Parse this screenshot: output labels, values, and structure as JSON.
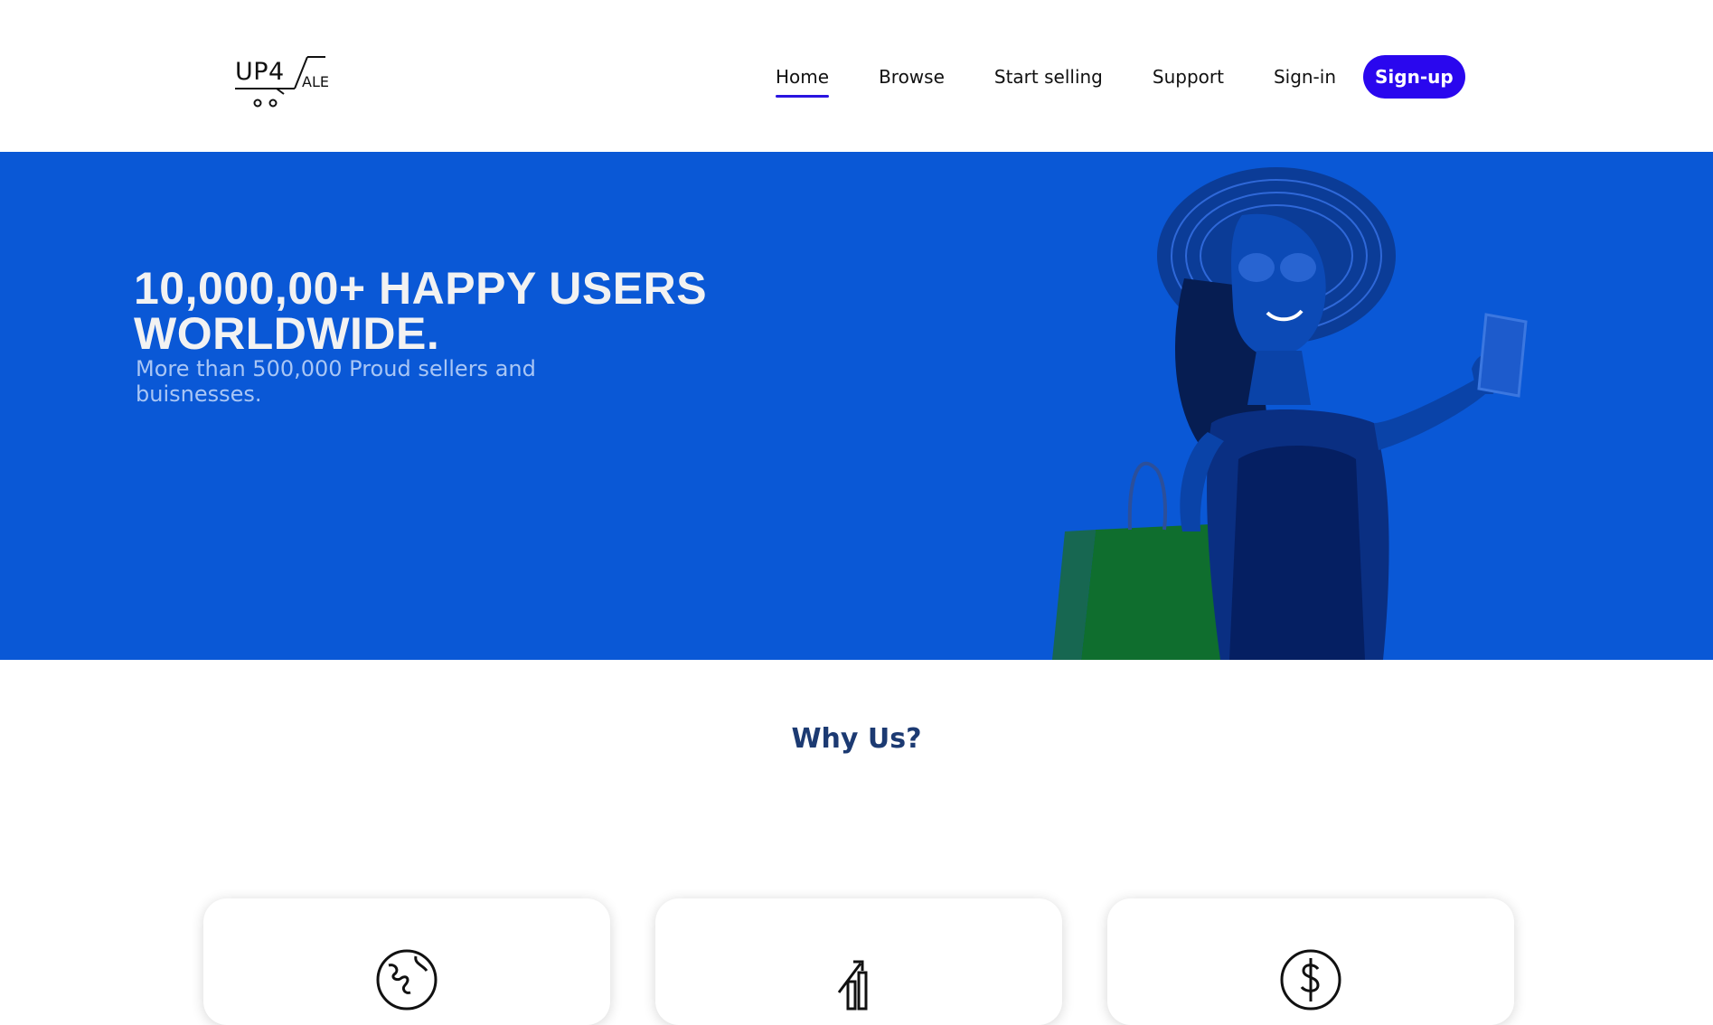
{
  "brand": {
    "logo_main": "UP4",
    "logo_sub": "ALE"
  },
  "nav": {
    "items": [
      {
        "label": "Home",
        "active": true
      },
      {
        "label": "Browse",
        "active": false
      },
      {
        "label": "Start selling",
        "active": false
      },
      {
        "label": "Support",
        "active": false
      },
      {
        "label": "Sign-in",
        "active": false
      }
    ],
    "signup_label": "Sign-up"
  },
  "hero": {
    "title_line1": "10,000,00+ HAPPY USERS",
    "title_line2": "WORLDWIDE.",
    "subtitle": "More than 500,000 Proud sellers and buisnesses.",
    "background_color": "#0a58d6"
  },
  "why_us": {
    "title": "Why Us?",
    "cards": [
      {
        "icon": "globe-icon"
      },
      {
        "icon": "growth-chart-icon"
      },
      {
        "icon": "dollar-coin-icon"
      }
    ]
  },
  "colors": {
    "accent": "#2a07ee",
    "heading": "#1c3a72"
  }
}
